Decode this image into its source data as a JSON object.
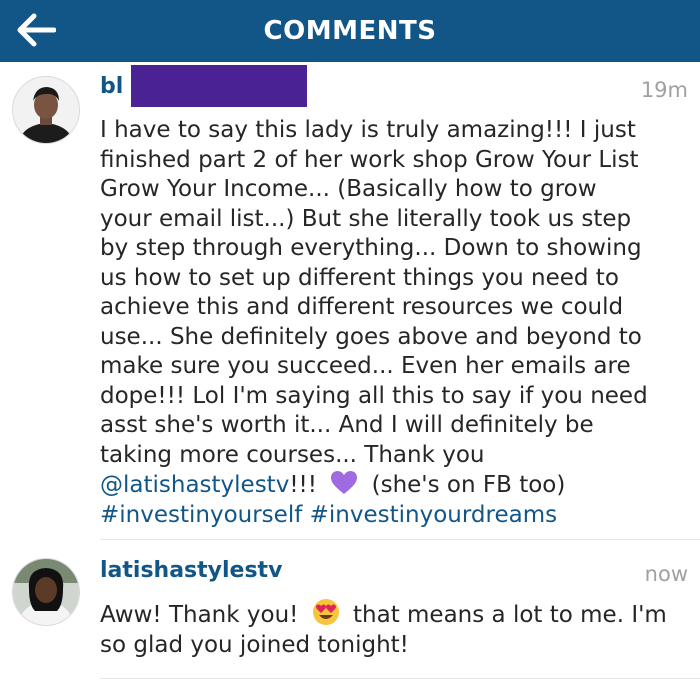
{
  "header": {
    "title": "COMMENTS",
    "back_icon": "back-arrow-icon",
    "background": "#125688"
  },
  "comments": [
    {
      "username_visible": "bl",
      "time": "19m",
      "text_lines": [
        "I have to say this lady is truly amazing!!! I just",
        "finished part 2 of her work shop Grow Your List",
        "Grow Your Income... (Basically how to grow",
        "your email list...) But she literally took us step",
        "by step through everything... Down to showing",
        "us how to set up different things you need to",
        "achieve this and different resources we could",
        "use... She definitely goes above and beyond to",
        "make sure you succeed... Even her emails are",
        "dope!!! Lol I'm saying all this to say if you need",
        "asst she's worth it... And I will definitely be",
        "taking more courses... Thank you"
      ],
      "mention": "@latishastylestv",
      "mention_suffix": "!!!",
      "emoji": "purple-heart-icon",
      "after_emoji": "(she's on FB too)",
      "hashtags": [
        "#investinyourself",
        "#investinyourdreams"
      ]
    },
    {
      "username": "latishastylestv",
      "time": "now",
      "text_part1": "Aww! Thank you!",
      "emoji": "heart-eyes-emoji-icon",
      "text_part2": "that means a lot to me. I'm",
      "text_line2": "so glad you joined tonight!"
    }
  ],
  "colors": {
    "link": "#125688",
    "redaction": "#4b2293"
  }
}
